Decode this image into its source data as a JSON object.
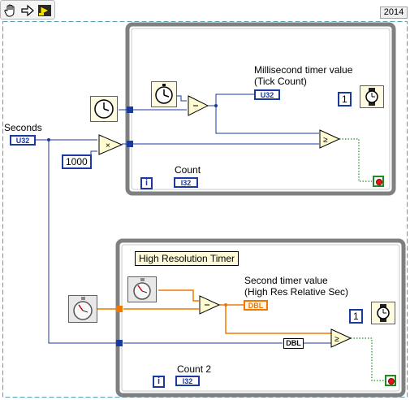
{
  "toolbar": {
    "buttons": [
      {
        "name": "hand-tool-icon"
      },
      {
        "name": "arrow-tool-icon"
      },
      {
        "name": "run-icon"
      }
    ]
  },
  "version_label": "2014",
  "inputs": {
    "seconds_label": "Seconds",
    "seconds_terminal": "U32",
    "multiplier_constant": "1000"
  },
  "loop1": {
    "indicator_label_line1": "Millisecond timer value",
    "indicator_label_line2": "(Tick Count)",
    "indicator_terminal": "U32",
    "wait_constant": "1",
    "count_label": "Count",
    "count_terminal": "I32",
    "iteration_glyph": "i"
  },
  "loop2": {
    "free_label": "High Resolution Timer",
    "indicator_label_line1": "Second timer value",
    "indicator_label_line2": "(High Res Relative Sec)",
    "indicator_terminal": "DBL",
    "conversion_label": "DBL",
    "wait_constant": "1",
    "count_label": "Count 2",
    "count_terminal": "I32",
    "iteration_glyph": "i"
  },
  "colors": {
    "loop_border": "#808080",
    "integer_wire": "#1a3aa0",
    "double_wire": "#f07800",
    "boolean_wire": "#1e8c1e",
    "diagram_border": "#5aa0b8"
  }
}
